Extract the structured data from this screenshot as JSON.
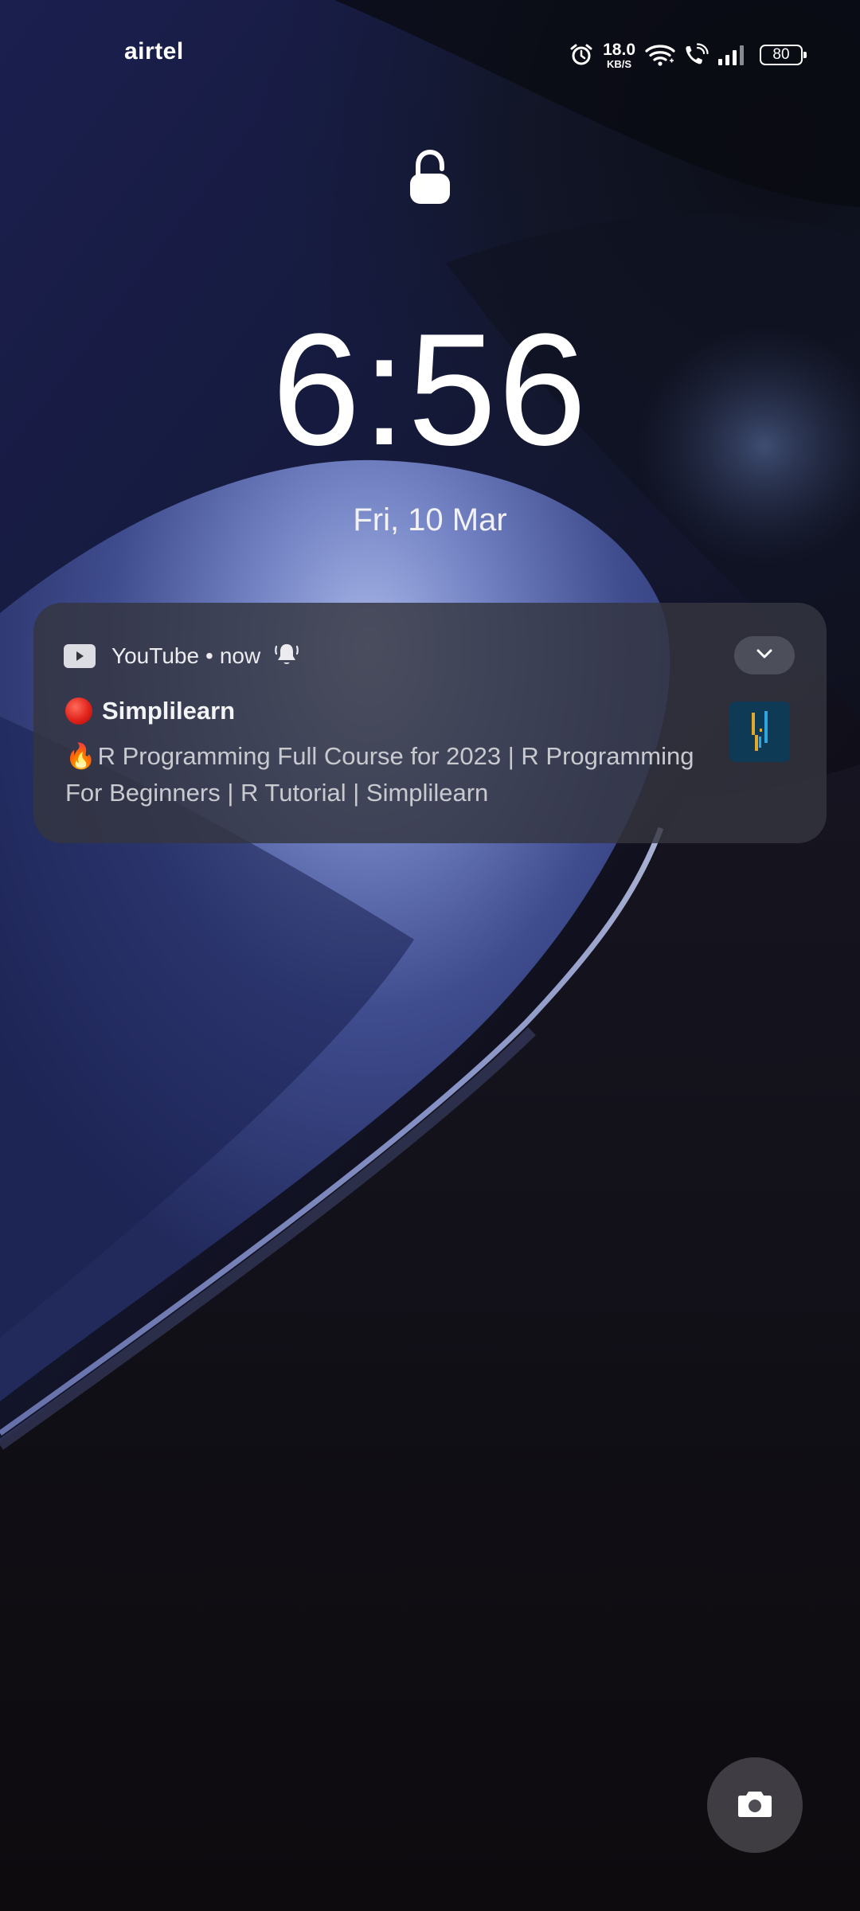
{
  "status_bar": {
    "carrier": "airtel",
    "net_speed_value": "18.0",
    "net_speed_unit": "KB/S",
    "battery_level": "80",
    "icons": [
      "alarm-icon",
      "wifi-icon",
      "wifi-calling-icon",
      "signal-icon",
      "battery-icon"
    ]
  },
  "lockscreen": {
    "lock_icon": "padlock-unlocked-icon",
    "time": "6:56",
    "date": "Fri, 10 Mar"
  },
  "notification": {
    "app_name": "YouTube",
    "separator": "•",
    "time": "now",
    "title_emoji": "🔴",
    "title": "Simplilearn",
    "body_emoji": "🔥",
    "body": "R Programming Full Course for 2023 | R Programming For Beginners | R Tutorial | Simplilearn",
    "icons": [
      "youtube-icon",
      "bell-icon",
      "chevron-down-icon"
    ]
  },
  "shortcuts": {
    "camera": "camera-icon"
  },
  "colors": {
    "wallpaper_dark": "#0d0c10",
    "wallpaper_blue": "#1e2558",
    "wave_highlight": "#8e9ad6",
    "notification_bg": "#343640"
  }
}
